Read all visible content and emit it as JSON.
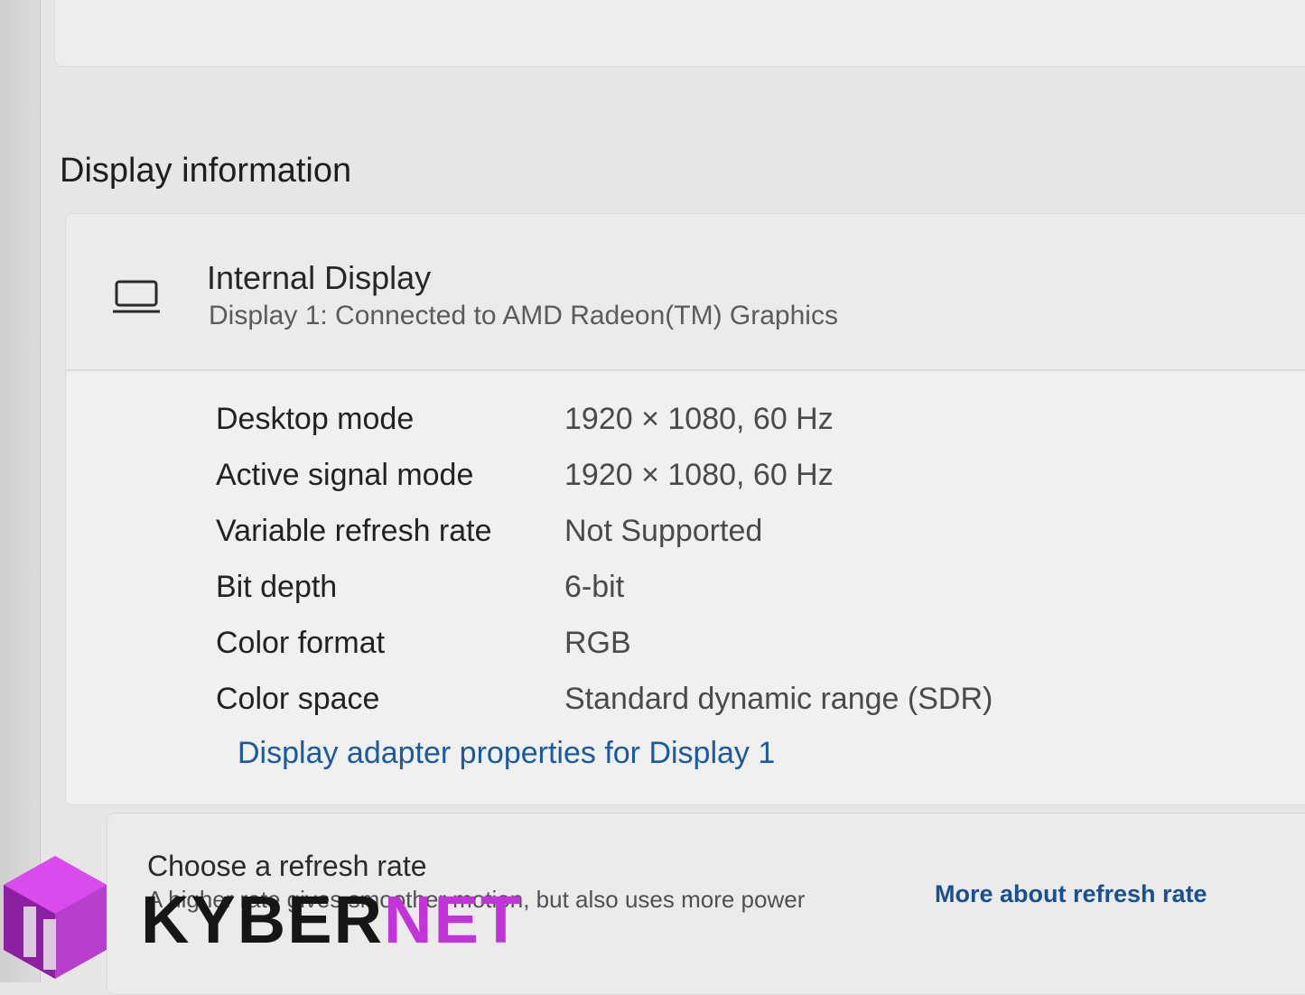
{
  "section_title": "Display information",
  "display": {
    "name": "Internal Display",
    "subtitle": "Display 1: Connected to AMD Radeon(TM) Graphics"
  },
  "properties": [
    {
      "label": "Desktop mode",
      "value": "1920 × 1080, 60 Hz"
    },
    {
      "label": "Active signal mode",
      "value": "1920 × 1080, 60 Hz"
    },
    {
      "label": "Variable refresh rate",
      "value": "Not Supported"
    },
    {
      "label": "Bit depth",
      "value": "6-bit"
    },
    {
      "label": "Color format",
      "value": "RGB"
    },
    {
      "label": "Color space",
      "value": "Standard dynamic range (SDR)"
    }
  ],
  "adapter_link": "Display adapter properties for Display 1",
  "refresh": {
    "title": "Choose a refresh rate",
    "description": "A higher rate gives smoother motion, but also uses more power",
    "link": "More about refresh rate"
  },
  "watermark": {
    "part1": "KYBER",
    "part2": "NET"
  },
  "colors": {
    "link": "#1b5aa0",
    "watermark_accent": "#c233d9"
  },
  "icons": {
    "display": "monitor-icon",
    "logo": "kybernet-logo-icon"
  }
}
